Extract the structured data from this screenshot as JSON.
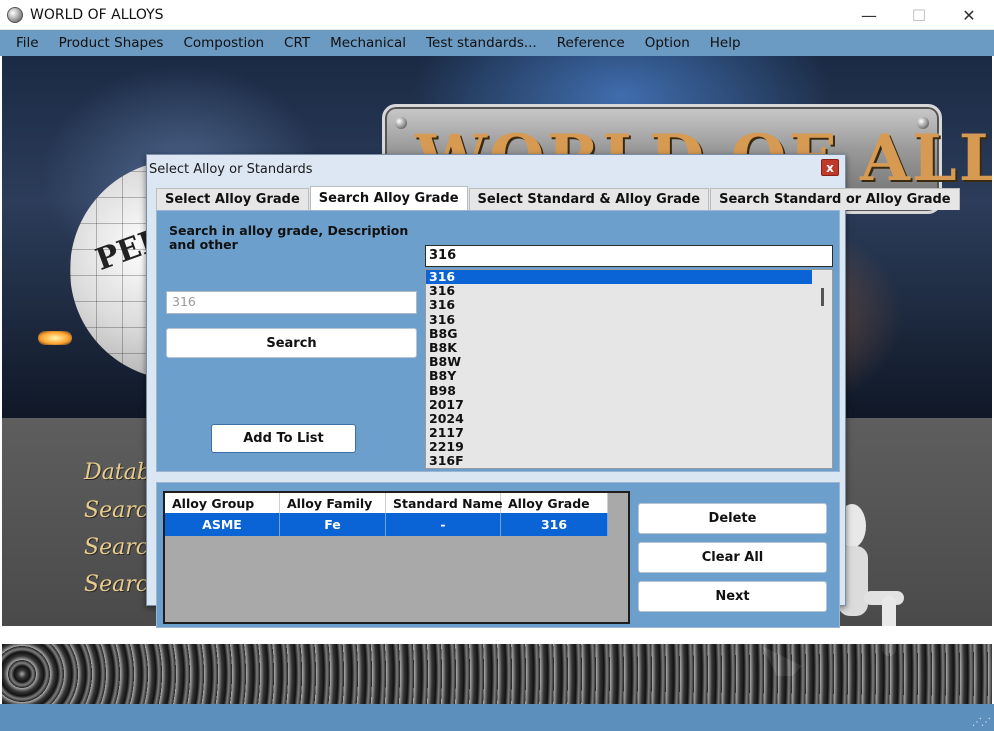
{
  "window": {
    "title": "WORLD OF ALLOYS",
    "minimize": "—",
    "maximize": "☐",
    "close": "✕"
  },
  "menu": [
    "File",
    "Product Shapes",
    "Compostion",
    "CRT",
    "Mechanical",
    "Test standards...",
    "Reference",
    "Option",
    "Help"
  ],
  "background": {
    "logo_text": "WORLD OF ALLOYS",
    "globe_text": "PERI OF T",
    "side_labels": [
      "Datab",
      "Search",
      "Search",
      "Search"
    ]
  },
  "dialog": {
    "title": "Select Alloy or Standards",
    "close": "x",
    "tabs": [
      "Select Alloy Grade",
      "Search Alloy Grade",
      "Select Standard & Alloy Grade",
      "Search Standard or Alloy Grade"
    ],
    "active_tab": 1,
    "search_label": "Search in alloy grade, Description and other",
    "search_value": "316",
    "search_button": "Search",
    "add_button": "Add To List",
    "grade_input": "316",
    "grade_list": [
      "316",
      "316",
      "316",
      "316",
      "B8G",
      "B8K",
      "B8W",
      "B8Y",
      "B98",
      "2017",
      "2024",
      "2117",
      "2219",
      "316F"
    ],
    "selected_index": 0,
    "table": {
      "headers": [
        "Alloy Group",
        "Alloy Family",
        "Standard Name",
        "Alloy Grade"
      ],
      "rows": [
        [
          "ASME",
          "Fe",
          "-",
          "316"
        ]
      ]
    },
    "delete_button": "Delete",
    "clear_button": "Clear All",
    "next_button": "Next"
  },
  "colors": {
    "menubar": "#6b9ac3",
    "panel": "#6c9fcb",
    "selection": "#0a64d6",
    "close_button": "#c0392b"
  }
}
